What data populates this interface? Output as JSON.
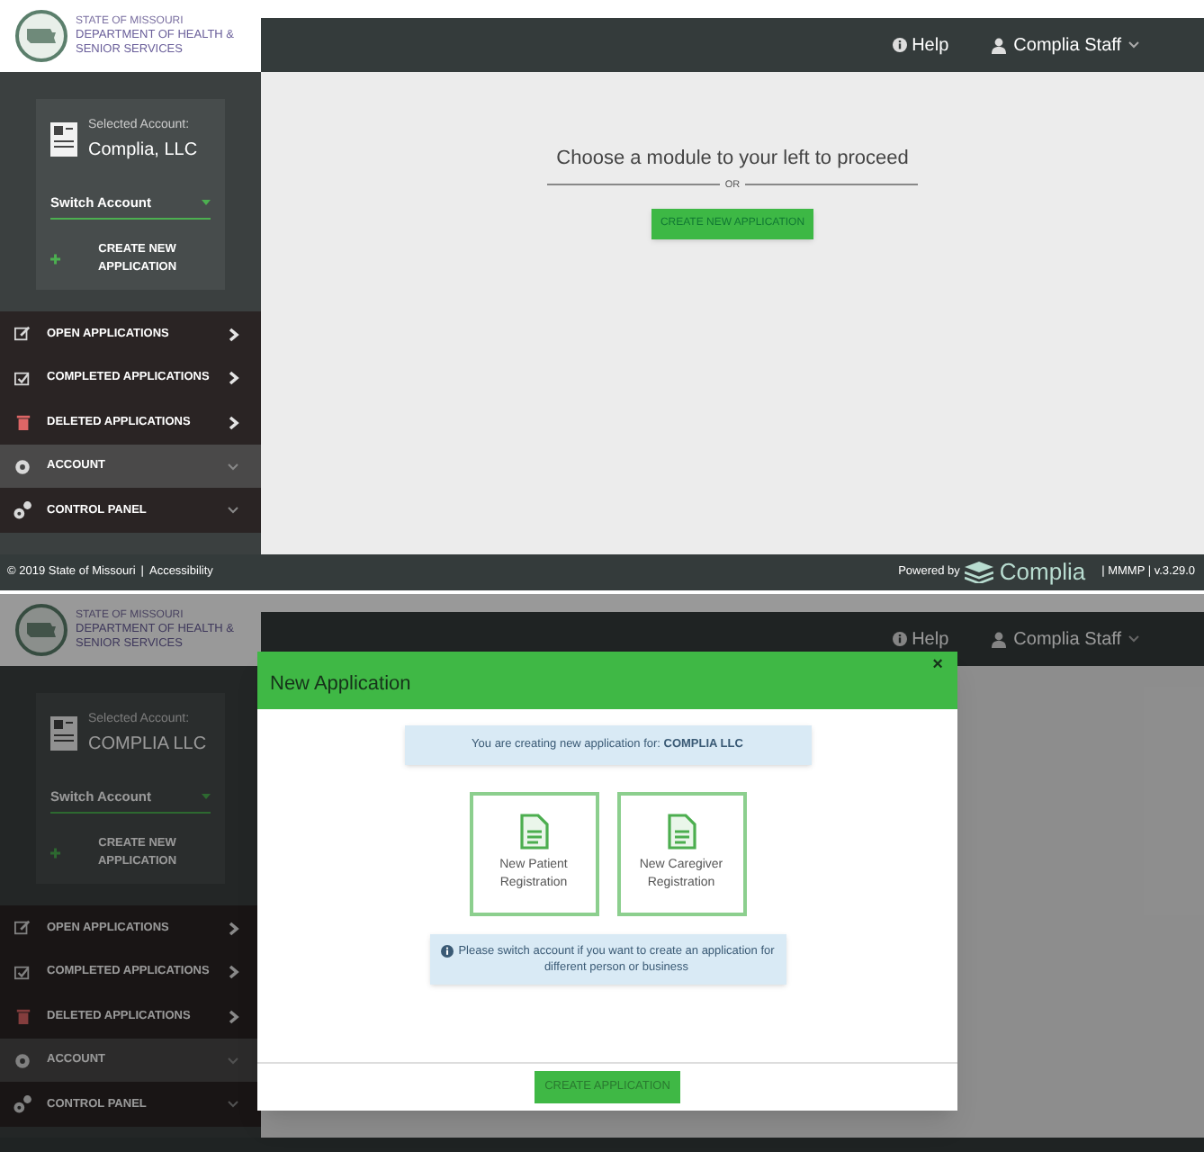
{
  "screens": [
    {
      "logo": {
        "line_1": "STATE OF MISSOURI",
        "line_2": "DEPARTMENT OF HEALTH &",
        "line_3": "SENIOR SERVICES"
      },
      "header": {
        "help": "Help",
        "user": "Complia Staff"
      },
      "account": {
        "label": "Selected Account:",
        "name": "Complia, LLC",
        "switch": "Switch Account",
        "create": "CREATE NEW APPLICATION"
      },
      "menu": [
        {
          "label": "OPEN APPLICATIONS",
          "kind": "link",
          "selected": false
        },
        {
          "label": "COMPLETED APPLICATIONS",
          "kind": "link",
          "selected": false
        },
        {
          "label": "DELETED APPLICATIONS",
          "kind": "link",
          "selected": false
        },
        {
          "label": "ACCOUNT",
          "kind": "group",
          "selected": true
        },
        {
          "label": "CONTROL PANEL",
          "kind": "group",
          "selected": false
        }
      ],
      "main": {
        "prompt": "Choose a module to your left to proceed",
        "divider": "OR",
        "button": "CREATE NEW APPLICATION"
      },
      "footer": {
        "copyright": "© 2019 State of Missouri",
        "separator": "|",
        "link": "Accessibility",
        "powered": "Powered by",
        "brand": "Complia",
        "version": "| MMMP | v.3.29.0"
      }
    },
    {
      "logo": {
        "line_1": "STATE OF MISSOURI",
        "line_2": "DEPARTMENT OF HEALTH &",
        "line_3": "SENIOR SERVICES"
      },
      "header": {
        "help": "Help",
        "user": "Complia Staff"
      },
      "account": {
        "label": "Selected Account:",
        "name": "COMPLIA LLC",
        "switch": "Switch Account",
        "create": "CREATE NEW APPLICATION"
      },
      "menu": [
        {
          "label": "OPEN APPLICATIONS",
          "kind": "link",
          "selected": false
        },
        {
          "label": "COMPLETED APPLICATIONS",
          "kind": "link",
          "selected": false
        },
        {
          "label": "DELETED APPLICATIONS",
          "kind": "link",
          "selected": false
        },
        {
          "label": "ACCOUNT",
          "kind": "group",
          "selected": true
        },
        {
          "label": "CONTROL PANEL",
          "kind": "group",
          "selected": false
        }
      ],
      "modal": {
        "title": "New Application",
        "close": "×",
        "notice": "You are creating new application for: **COMPLIA LLC**",
        "options": [
          {
            "label": "New Patient Registration"
          },
          {
            "label": "New Caregiver Registration"
          }
        ],
        "info": "Please switch account if you want to create an application for different person or business",
        "button": "CREATE APPLICATION"
      }
    }
  ]
}
